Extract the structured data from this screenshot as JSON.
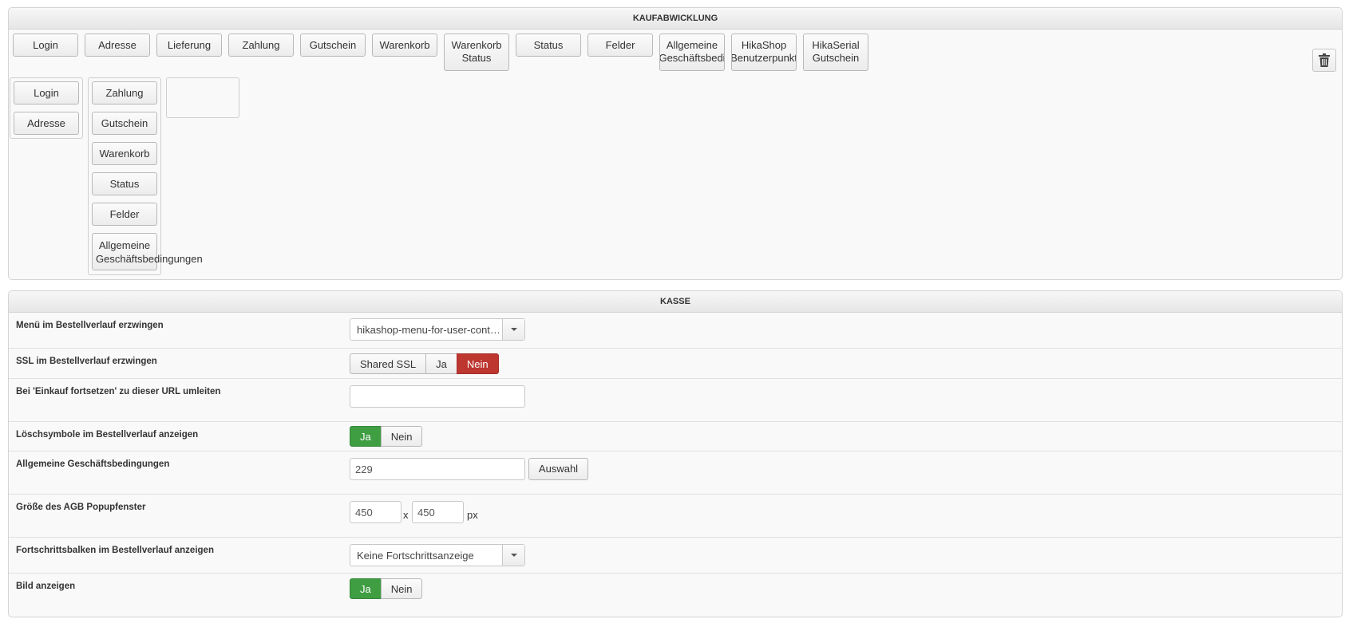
{
  "kaufabwicklung": {
    "title": "KAUFABWICKLUNG",
    "toolbar": [
      "Login",
      "Adresse",
      "Lieferung",
      "Zahlung",
      "Gutschein",
      "Warenkorb",
      [
        "Warenkorb",
        "Status"
      ],
      "Status",
      "Felder",
      [
        "Allgemeine",
        "Geschäftsbedi"
      ],
      [
        "HikaShop",
        "Benutzerpunkt"
      ],
      [
        "HikaSerial",
        "Gutschein"
      ]
    ],
    "column1": [
      "Login",
      "Adresse"
    ],
    "column2": [
      "Zahlung",
      "Gutschein",
      "Warenkorb",
      "Status",
      "Felder",
      [
        "Allgemeine",
        "Geschäftsbedingungen"
      ]
    ],
    "trash_icon": "trash-icon"
  },
  "kasse": {
    "title": "KASSE",
    "menu": {
      "label": "Menü im Bestellverlauf erzwingen",
      "value": "hikashop-menu-for-user-cont…"
    },
    "ssl": {
      "label": "SSL im Bestellverlauf erzwingen",
      "options": [
        "Shared SSL",
        "Ja",
        "Nein"
      ],
      "selected": "Nein"
    },
    "redirect": {
      "label": "Bei 'Einkauf fortsetzen' zu dieser URL umleiten",
      "value": ""
    },
    "delete_icons": {
      "label": "Löschsymbole im Bestellverlauf anzeigen",
      "options": [
        "Ja",
        "Nein"
      ],
      "selected": "Ja"
    },
    "terms": {
      "label": "Allgemeine Geschäftsbedingungen",
      "value": "229",
      "button": "Auswahl"
    },
    "popup_size": {
      "label": "Größe des AGB Popupfenster",
      "width": "450",
      "height": "450",
      "separator": "x",
      "unit": "px"
    },
    "progress": {
      "label": "Fortschrittsbalken im Bestellverlauf anzeigen",
      "value": "Keine Fortschrittsanzeige"
    },
    "image": {
      "label": "Bild anzeigen",
      "options": [
        "Ja",
        "Nein"
      ],
      "selected": "Ja"
    }
  }
}
